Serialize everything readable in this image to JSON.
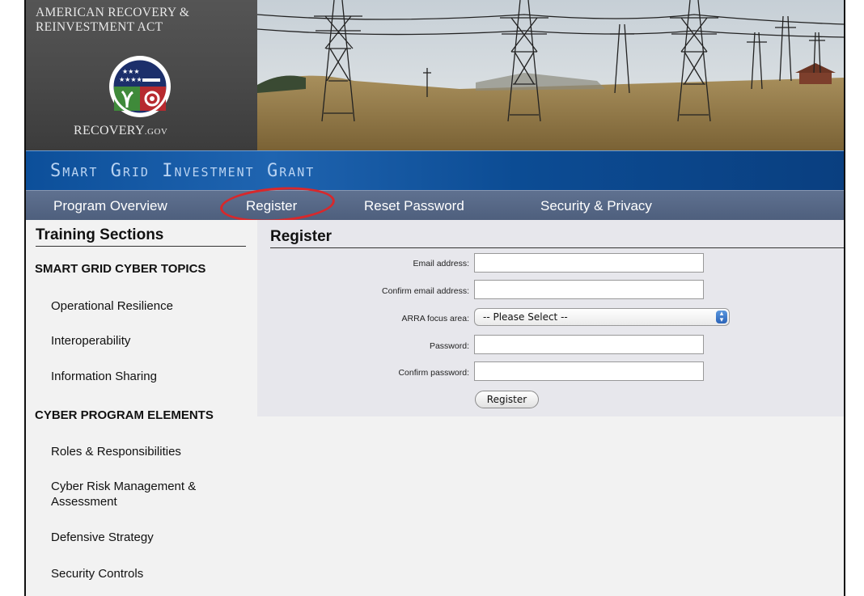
{
  "header": {
    "recovery_title": "AMERICAN RECOVERY & REINVESTMENT ACT",
    "recovery_site": "RECOVERY",
    "recovery_site_suffix": ".GOV",
    "seal_text": "RECOVERY.GOV"
  },
  "banner": {
    "title": "Smart Grid Investment Grant"
  },
  "nav": {
    "items": [
      {
        "label": "Program Overview"
      },
      {
        "label": "Register"
      },
      {
        "label": "Reset Password"
      },
      {
        "label": "Security & Privacy"
      }
    ],
    "highlight_color": "#d8282b"
  },
  "sidebar": {
    "heading": "Training Sections",
    "sections": [
      {
        "title": "SMART GRID CYBER TOPICS",
        "links": [
          "Operational Resilience",
          "Interoperability",
          "Information Sharing"
        ]
      },
      {
        "title": "CYBER PROGRAM ELEMENTS",
        "links": [
          "Roles & Responsibilities",
          "Cyber Risk Management & Assessment",
          "Defensive Strategy",
          "Security Controls"
        ]
      }
    ]
  },
  "form": {
    "heading": "Register",
    "fields": [
      {
        "label": "Email address:",
        "value": ""
      },
      {
        "label": "Confirm email address:",
        "value": ""
      },
      {
        "label": "ARRA focus area:",
        "selected": "-- Please Select --"
      },
      {
        "label": "Password:",
        "value": ""
      },
      {
        "label": "Confirm password:",
        "value": ""
      }
    ],
    "submit_label": "Register"
  },
  "colors": {
    "banner_blue": "#0c4f9a",
    "nav_slate": "#4e5f7d",
    "form_bg": "#e7e7ec",
    "page_bg": "#f2f2f2"
  }
}
